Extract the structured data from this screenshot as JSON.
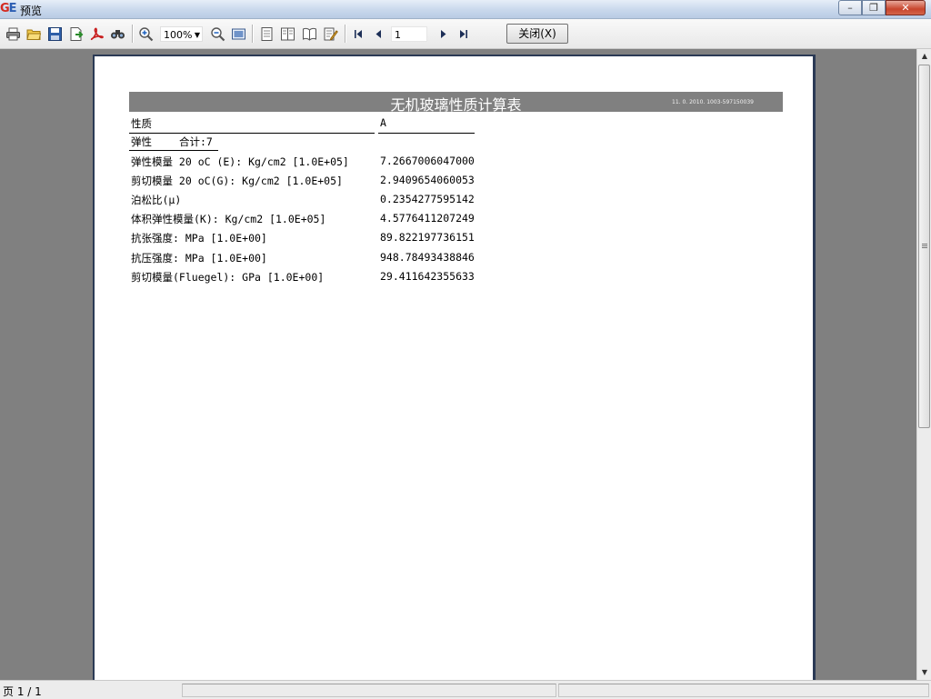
{
  "window": {
    "title": "预览",
    "logo": {
      "left": "G",
      "right": "E"
    },
    "buttons": {
      "minimize": "–",
      "maximize": "❐",
      "close": "✕"
    }
  },
  "toolbar": {
    "zoom_value": "100%",
    "page_value": "1",
    "close_label": "关闭(X)",
    "icons": [
      "print-icon",
      "open-folder-icon",
      "save-icon",
      "export-icon",
      "pdf-icon",
      "find-icon",
      "zoom-in-icon",
      "zoom-out-icon",
      "fit-page-icon",
      "single-page-icon",
      "two-page-icon",
      "book-view-icon",
      "edit-icon",
      "first-page-icon",
      "prev-page-icon",
      "next-page-icon",
      "last-page-icon"
    ]
  },
  "report": {
    "title": "无机玻璃性质计算表",
    "code": "11. 0. 2010. 1003-597150039",
    "col_property": "性质",
    "col_value": "A",
    "group_name": "弹性",
    "group_total": "合计:7",
    "rows": [
      {
        "label": "弹性模量 20 oC (E): Kg/cm2 [1.0E+05]",
        "value": "7.2667006047000"
      },
      {
        "label": "剪切模量 20 oC(G): Kg/cm2 [1.0E+05]",
        "value": "2.9409654060053"
      },
      {
        "label": "泊松比(μ)",
        "value": "0.2354277595142"
      },
      {
        "label": "体积弹性模量(K): Kg/cm2 [1.0E+05]",
        "value": "4.5776411207249"
      },
      {
        "label": "抗张强度: MPa [1.0E+00]",
        "value": "89.822197736151"
      },
      {
        "label": "抗压强度: MPa [1.0E+00]",
        "value": "948.78493438846"
      },
      {
        "label": "剪切模量(Fluegel): GPa [1.0E+00]",
        "value": "29.411642355633"
      }
    ]
  },
  "status": {
    "page_info": "页 1 / 1"
  }
}
